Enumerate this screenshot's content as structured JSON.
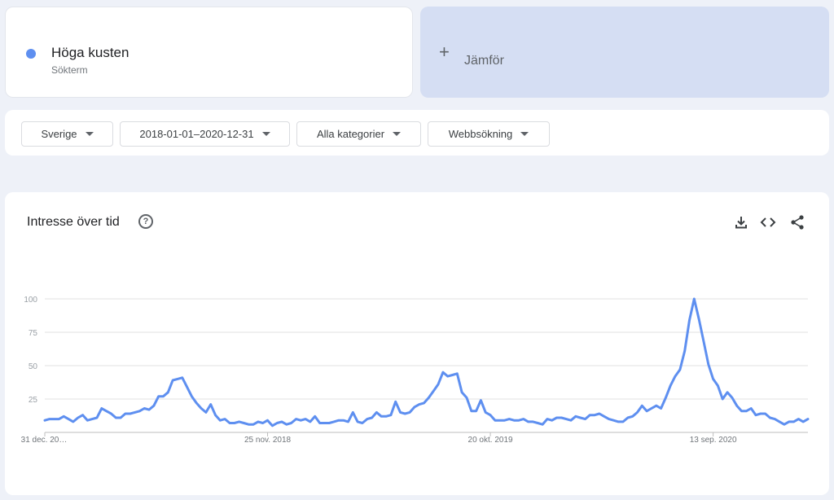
{
  "term": {
    "name": "Höga kusten",
    "subtitle": "Sökterm",
    "color": "#5e8ff0"
  },
  "compare": {
    "icon": "plus-icon",
    "label": "Jämför"
  },
  "filters": [
    {
      "label": "Sverige"
    },
    {
      "label": "2018-01-01–2020-12-31"
    },
    {
      "label": "Alla kategorier"
    },
    {
      "label": "Webbsökning"
    }
  ],
  "chart_card": {
    "title": "Intresse över tid",
    "icons": [
      "help-icon",
      "download-icon",
      "embed-icon",
      "share-icon"
    ]
  },
  "chart_data": {
    "type": "line",
    "title": "",
    "xlabel": "",
    "ylabel": "",
    "ylim": [
      0,
      100
    ],
    "yticks": [
      25,
      50,
      75,
      100
    ],
    "grid": true,
    "x_tick_labels": [
      {
        "label": "31 dec. 20…",
        "index": 0
      },
      {
        "label": "25 nov. 2018",
        "index": 47
      },
      {
        "label": "20 okt. 2019",
        "index": 94
      },
      {
        "label": "13 sep. 2020",
        "index": 141
      }
    ],
    "series": [
      {
        "color": "#5e8ff0",
        "values": [
          9,
          10,
          10,
          10,
          12,
          10,
          8,
          11,
          13,
          9,
          10,
          11,
          18,
          16,
          14,
          11,
          11,
          14,
          14,
          15,
          16,
          18,
          17,
          20,
          27,
          27,
          30,
          39,
          40,
          41,
          34,
          27,
          22,
          18,
          15,
          21,
          13,
          9,
          10,
          7,
          7,
          8,
          7,
          6,
          6,
          8,
          7,
          9,
          5,
          7,
          8,
          6,
          7,
          10,
          9,
          10,
          8,
          12,
          7,
          7,
          7,
          8,
          9,
          9,
          8,
          15,
          8,
          7,
          10,
          11,
          15,
          12,
          12,
          13,
          23,
          15,
          14,
          15,
          19,
          21,
          22,
          26,
          31,
          36,
          45,
          42,
          43,
          44,
          30,
          26,
          16,
          16,
          24,
          15,
          13,
          9,
          9,
          9,
          10,
          9,
          9,
          10,
          8,
          8,
          7,
          6,
          10,
          9,
          11,
          11,
          10,
          9,
          12,
          11,
          10,
          13,
          13,
          14,
          12,
          10,
          9,
          8,
          8,
          11,
          12,
          15,
          20,
          16,
          18,
          20,
          18,
          26,
          35,
          42,
          47,
          61,
          84,
          100,
          85,
          68,
          51,
          40,
          35,
          25,
          30,
          26,
          20,
          16,
          16,
          18,
          13,
          14,
          14,
          11,
          10,
          8,
          6,
          8,
          8,
          10,
          8,
          10
        ]
      }
    ]
  }
}
